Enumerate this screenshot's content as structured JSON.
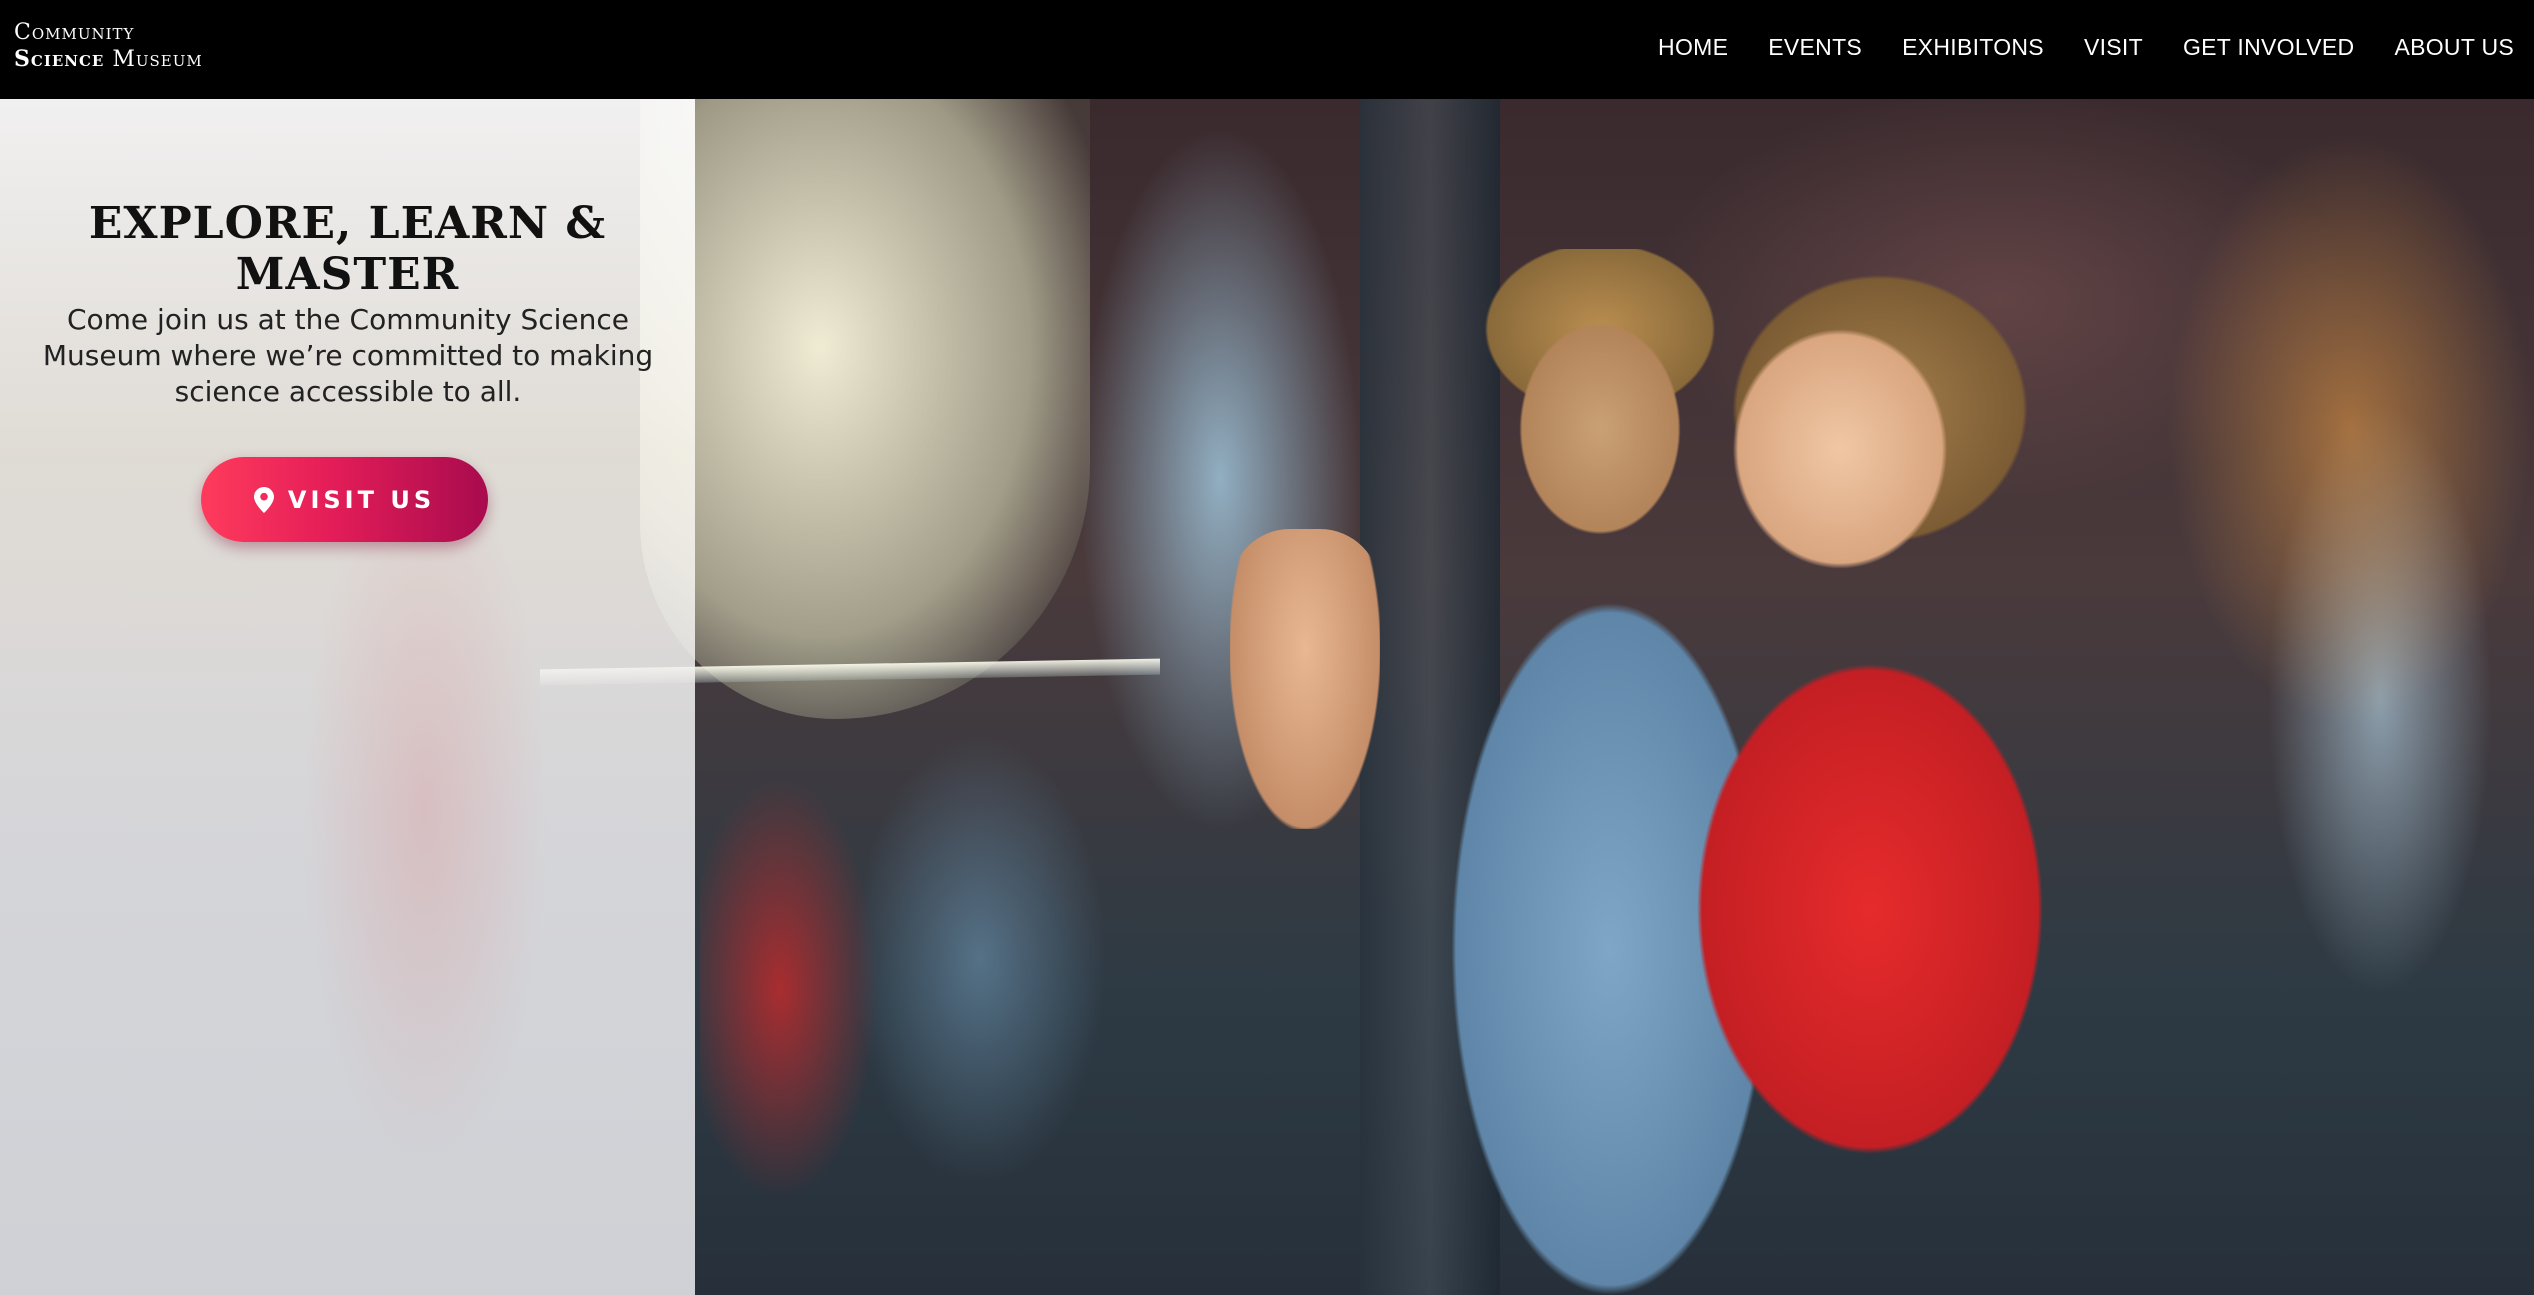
{
  "logo": {
    "line1": "Community",
    "line2_bold": "Science",
    "line2_rest": " Museum"
  },
  "nav": {
    "items": [
      {
        "label": "HOME"
      },
      {
        "label": "EVENTS"
      },
      {
        "label": "EXHIBITONS"
      },
      {
        "label": "VISIT"
      },
      {
        "label": "GET INVOLVED"
      },
      {
        "label": "ABOUT US"
      }
    ]
  },
  "hero": {
    "headline": "EXPLORE, LEARN & MASTER",
    "subtext": "Come join us at the Community Science Museum where we’re committed to making science accessible to all.",
    "button_label": "VISIT US",
    "button_icon": "map-pin-icon"
  },
  "colors": {
    "header_bg": "#000000",
    "button_gradient_start": "#ff3b5c",
    "button_gradient_end": "#a80b4e"
  }
}
